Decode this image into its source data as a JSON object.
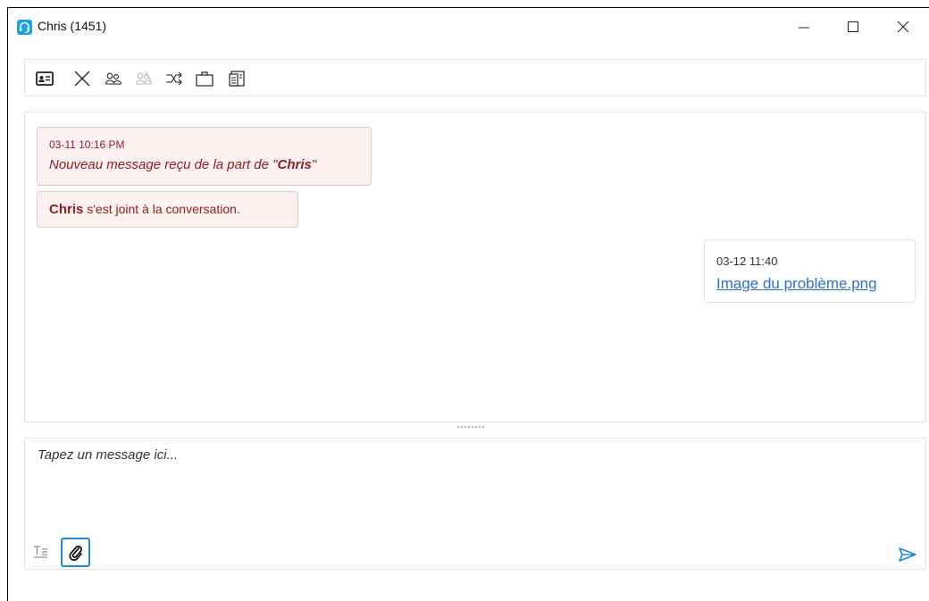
{
  "window": {
    "title": "Chris (1451)",
    "icons": {
      "app": "headset-icon",
      "minimize": "minimize-icon",
      "maximize": "maximize-icon",
      "close": "close-icon"
    }
  },
  "toolbar": {
    "items": [
      {
        "icon": "contact-card-icon"
      },
      {
        "icon": "close-conversation-icon"
      },
      {
        "icon": "invite-user-icon"
      },
      {
        "icon": "remove-user-icon",
        "disabled": true
      },
      {
        "icon": "transfer-icon"
      },
      {
        "icon": "briefcase-icon"
      },
      {
        "icon": "history-icon"
      }
    ]
  },
  "conversation": {
    "messages": [
      {
        "direction": "incoming",
        "timestamp": "03-11 10:16 PM",
        "text_prefix": "Nouveau message reçu de la part de \"",
        "sender": "Chris",
        "text_suffix": "\""
      },
      {
        "direction": "system",
        "sender": "Chris",
        "text": " s'est joint à la conversation."
      },
      {
        "direction": "outgoing",
        "timestamp": "03-12 11:40",
        "attachment": "Image du problème.png"
      }
    ]
  },
  "compose": {
    "placeholder": "Tapez un message ici...",
    "value": "",
    "icons": {
      "format": "text-format-icon",
      "attach": "paperclip-icon",
      "send": "send-icon"
    }
  },
  "colors": {
    "accent": "#1e8ad6",
    "incoming_text": "#8e1f24",
    "incoming_bg": "#fdf1f1",
    "link": "#2f6fcf"
  }
}
